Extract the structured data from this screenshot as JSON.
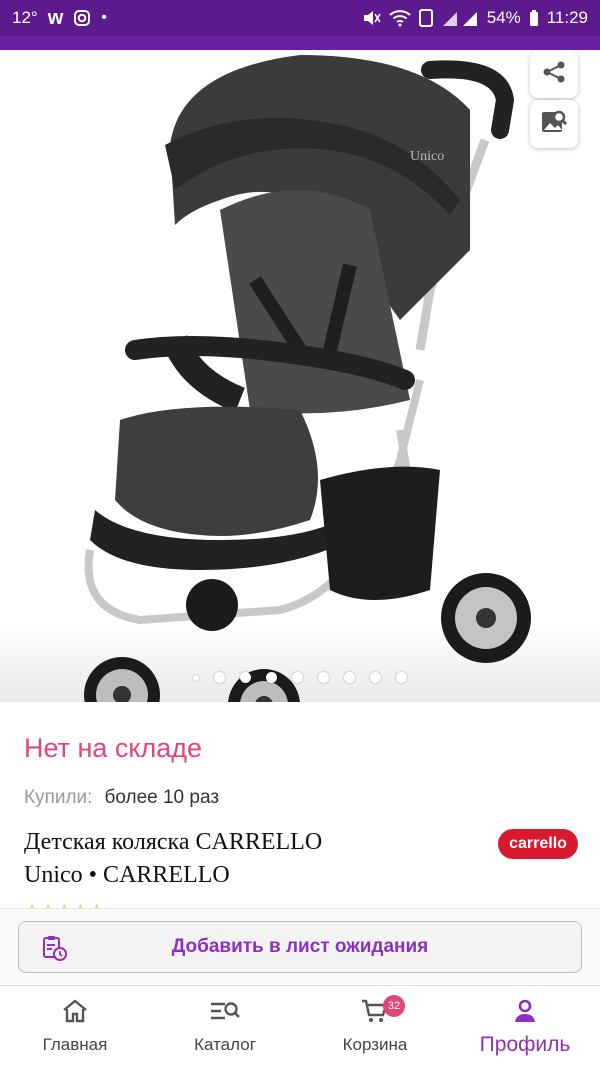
{
  "status_bar": {
    "temperature": "12°",
    "battery": "54%",
    "time": "11:29"
  },
  "gallery": {
    "total_images": 9,
    "current_index": 1,
    "product_logo_text": "Unico"
  },
  "product": {
    "stock_status": "Нет на складе",
    "bought_label": "Купили:",
    "bought_value": "более 10 раз",
    "title_line1": "Детская коляска CARRELLO",
    "title_line2": "Unico • CARRELLO",
    "brand_logo": "carrello",
    "rating_stars": "★★★★★"
  },
  "actions": {
    "waitlist_label": "Добавить в лист ожидания"
  },
  "bottom_nav": {
    "items": [
      {
        "label": "Главная",
        "icon": "home-icon"
      },
      {
        "label": "Каталог",
        "icon": "catalog-search-icon"
      },
      {
        "label": "Корзина",
        "icon": "cart-icon",
        "badge": "32"
      },
      {
        "label": "Профиль",
        "icon": "profile-icon",
        "active": true
      }
    ]
  },
  "colors": {
    "status_bar": "#5d1a8c",
    "accent": "#8e2fbf",
    "stock": "#e0457b",
    "brand_red": "#d91a2e"
  }
}
